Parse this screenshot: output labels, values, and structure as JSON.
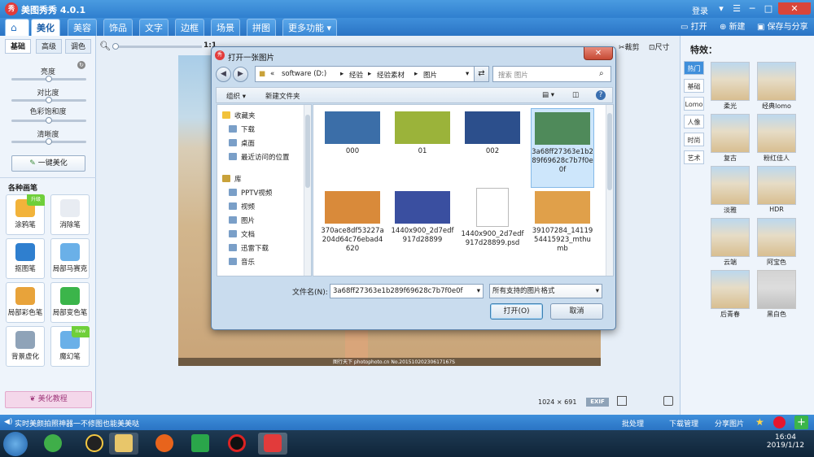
{
  "app": {
    "title": "美图秀秀 4.0.1",
    "logo_text": "秀",
    "login": "登录",
    "tabs": [
      "美化",
      "美容",
      "饰品",
      "文字",
      "边框",
      "场景",
      "拼图",
      "更多功能"
    ],
    "right_tools": {
      "open": "打开",
      "new": "新建",
      "save": "保存与分享"
    },
    "colors": {
      "titlebar": "#2f7fcf",
      "accent": "#3f8fdb"
    }
  },
  "left": {
    "tabs": [
      "基础",
      "高级",
      "调色"
    ],
    "sliders": [
      {
        "label": "亮度",
        "value": 0.5
      },
      {
        "label": "对比度",
        "value": 0.5
      },
      {
        "label": "色彩饱和度",
        "value": 0.5
      },
      {
        "label": "清晰度",
        "value": 0.5
      }
    ],
    "one_click": "一键美化",
    "brushes_title": "各种画笔",
    "tools": [
      {
        "label": "涂鸦笔",
        "icon": "pencil-icon",
        "badge": "升级"
      },
      {
        "label": "消除笔",
        "icon": "eraser-icon"
      },
      {
        "label": "抠图笔",
        "icon": "cutout-pen-icon"
      },
      {
        "label": "局部马赛克",
        "icon": "mosaic-icon"
      },
      {
        "label": "局部彩色笔",
        "icon": "color-brush-icon"
      },
      {
        "label": "局部变色笔",
        "icon": "recolor-bucket-icon"
      },
      {
        "label": "背景虚化",
        "icon": "blur-background-icon"
      },
      {
        "label": "魔幻笔",
        "icon": "magic-wand-icon",
        "badge": "new"
      }
    ],
    "tutorial": "美化教程"
  },
  "canvas": {
    "zoom_label": "1:1",
    "crop": "裁剪",
    "size": "尺寸",
    "watermark": "图行天下 photophoto.cn No.20151020230617167S",
    "dimensions": "1024 × 691",
    "exif": "EXIF"
  },
  "right": {
    "title": "特效：",
    "tabs": [
      "热门",
      "基础",
      "Lomo",
      "人像",
      "时尚",
      "艺术"
    ],
    "effects": [
      "柔光",
      "经典lomo",
      "复古",
      "粉红佳人",
      "淡雅",
      "HDR",
      "云端",
      "阿宝色",
      "后青春",
      "黑白色"
    ]
  },
  "bottom": {
    "tip": "实时美颜拍照神器一不修图也能美美哒",
    "batch": "批处理",
    "download": "下载管理",
    "share": "分享图片"
  },
  "dialog": {
    "title": "打开一张图片",
    "address": [
      "«",
      "software (D:)",
      "经验",
      "经验素材",
      "图片"
    ],
    "search_placeholder": "搜索 图片",
    "organize": "组织 ▾",
    "new_folder": "新建文件夹",
    "nav": [
      {
        "label": "收藏夹",
        "icon": "star-icon",
        "indent": 0
      },
      {
        "label": "下载",
        "icon": "download-folder-icon",
        "indent": 1
      },
      {
        "label": "桌面",
        "icon": "desktop-icon",
        "indent": 1
      },
      {
        "label": "最近访问的位置",
        "icon": "recent-places-icon",
        "indent": 1
      },
      {
        "label": "库",
        "icon": "library-icon",
        "indent": 0
      },
      {
        "label": "PPTV视频",
        "icon": "video-folder-icon",
        "indent": 1
      },
      {
        "label": "视频",
        "icon": "video-folder-icon",
        "indent": 1
      },
      {
        "label": "图片",
        "icon": "pictures-folder-icon",
        "indent": 1
      },
      {
        "label": "文档",
        "icon": "documents-folder-icon",
        "indent": 1
      },
      {
        "label": "迅雷下载",
        "icon": "thunder-folder-icon",
        "indent": 1
      },
      {
        "label": "音乐",
        "icon": "music-folder-icon",
        "indent": 1
      }
    ],
    "files": [
      {
        "name": "000",
        "color": "#3b6ea8",
        "selected": false
      },
      {
        "name": "01",
        "color": "#9bb33a",
        "selected": false
      },
      {
        "name": "002",
        "color": "#2c4f8c",
        "selected": false
      },
      {
        "name": "3a68ff27363e1b289f69628c7b7f0e0f",
        "color": "#4f8a5a",
        "selected": true
      },
      {
        "name": "370ace8df53227a204d64c76ebad4620",
        "color": "#d98a3a",
        "selected": false
      },
      {
        "name": "1440x900_2d7edf917d28899",
        "color": "#3a4fa0",
        "selected": false
      },
      {
        "name": "1440x900_2d7edf917d28899.psd",
        "color": "#ffffff",
        "selected": false
      },
      {
        "name": "39107284_1411954415923_mthumb",
        "color": "#e0a04a",
        "selected": false
      }
    ],
    "filename_label": "文件名(N):",
    "filename_value": "3a68ff27363e1b289f69628c7b7f0e0f",
    "filetype": "所有支持的图片格式",
    "open": "打开(O)",
    "cancel": "取消"
  },
  "taskbar": {
    "time": "16:04",
    "date": "2019/1/12"
  }
}
